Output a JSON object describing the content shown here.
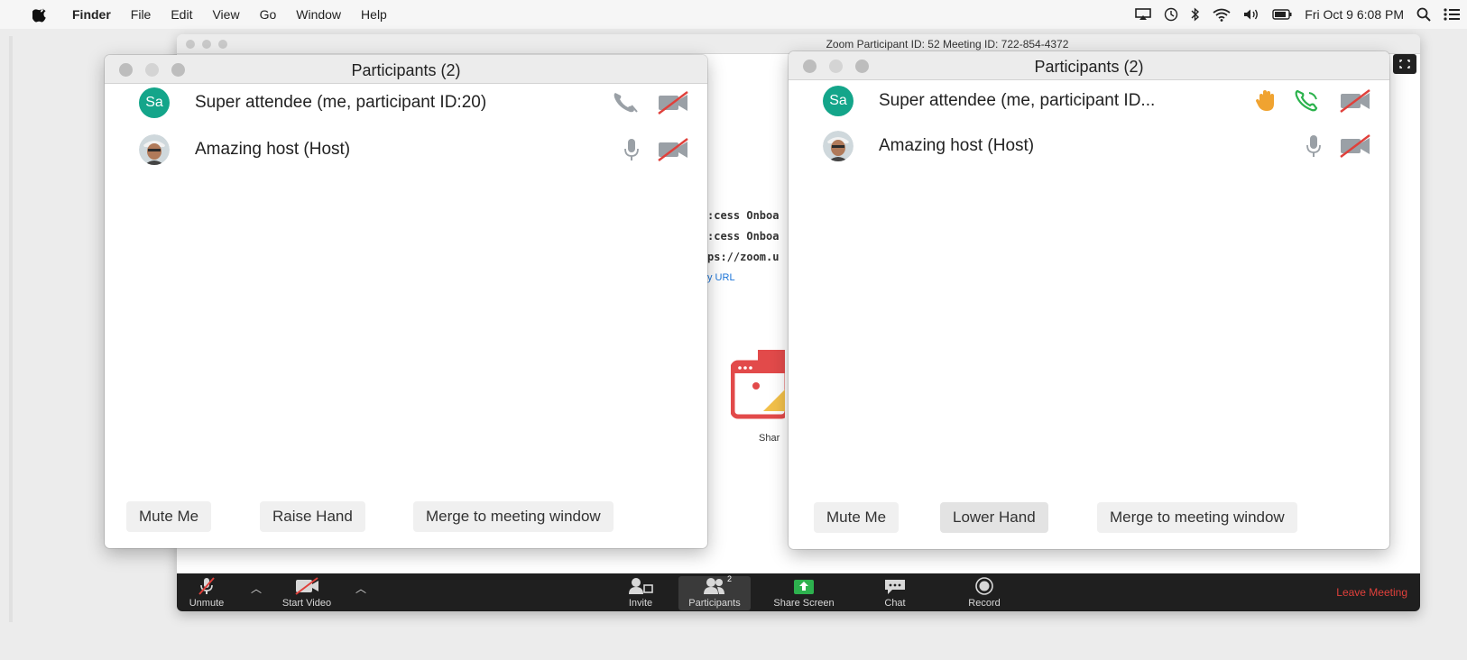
{
  "menubar": {
    "app_name": "Finder",
    "items": [
      "File",
      "Edit",
      "View",
      "Go",
      "Window",
      "Help"
    ],
    "clock": "Fri Oct 9  6:08 PM"
  },
  "zoom_window": {
    "title": "Zoom Participant ID: 52   Meeting ID: 722-854-4372",
    "info_lines": [
      ":cess Onboa",
      ":cess Onboa",
      "ps://zoom.u"
    ],
    "copy_url": "y URL",
    "share_label": "Shar",
    "toolbar": {
      "unmute": "Unmute",
      "start_video": "Start Video",
      "invite": "Invite",
      "participants": "Participants",
      "participants_count": "2",
      "share_screen": "Share Screen",
      "chat": "Chat",
      "record": "Record",
      "leave": "Leave Meeting"
    }
  },
  "participants_left": {
    "title": "Participants (2)",
    "rows": [
      {
        "initials": "Sa",
        "name": "Super attendee (me, participant ID:20)"
      },
      {
        "name": "Amazing host (Host)"
      }
    ],
    "buttons": {
      "mute": "Mute Me",
      "hand": "Raise Hand",
      "merge": "Merge to meeting window"
    }
  },
  "participants_right": {
    "title": "Participants (2)",
    "rows": [
      {
        "initials": "Sa",
        "name": "Super attendee (me, participant ID..."
      },
      {
        "name": "Amazing host (Host)"
      }
    ],
    "buttons": {
      "mute": "Mute Me",
      "hand": "Lower Hand",
      "merge": "Merge to meeting window"
    }
  },
  "colors": {
    "avatar": "#14a58a",
    "muted_red": "#e0403b",
    "hand": "#f0a330",
    "leave": "#e0403b"
  }
}
